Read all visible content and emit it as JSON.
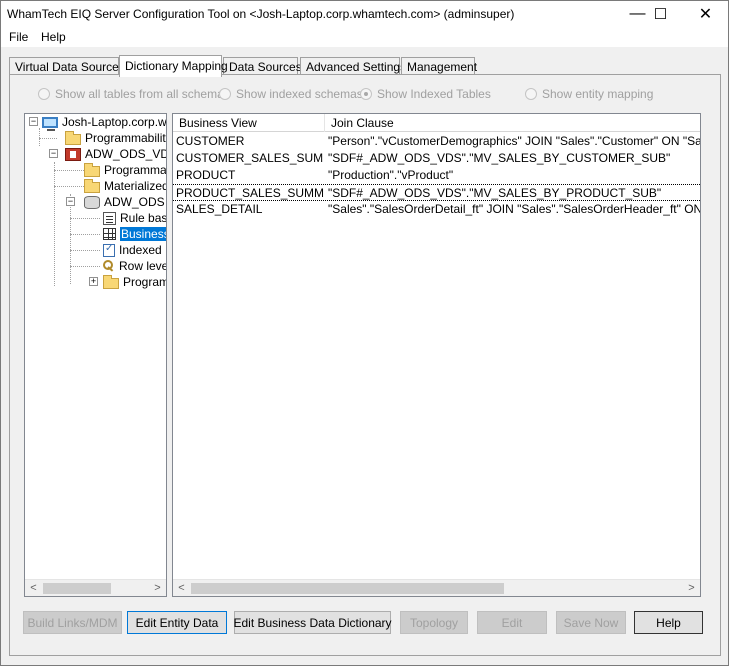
{
  "window": {
    "title": "WhamTech EIQ Server Configuration Tool on <Josh-Laptop.corp.whamtech.com> (adminsuper)",
    "minimize": "—",
    "maximize": "☐",
    "close": "✕"
  },
  "menu": [
    "File",
    "Help"
  ],
  "tabs": [
    "Virtual Data Sources",
    "Dictionary Mapping",
    "Data Sources",
    "Advanced Settings",
    "Management"
  ],
  "active_tab": "Dictionary Mapping",
  "radios": [
    {
      "label": "Show all tables from all schemas",
      "checked": false
    },
    {
      "label": "Show indexed schemas",
      "checked": false
    },
    {
      "label": "Show Indexed Tables",
      "checked": true
    },
    {
      "label": "Show entity mapping",
      "checked": false
    }
  ],
  "tree": {
    "items": [
      {
        "label": "Josh-Laptop.corp.whamtech.com",
        "icon": "computer-icon"
      },
      {
        "label": "Programmability",
        "icon": "folder-icon"
      },
      {
        "label": "ADW_ODS_VDS",
        "icon": "vds-icon"
      },
      {
        "label": "Programmability",
        "icon": "folder-icon"
      },
      {
        "label": "Materialized",
        "icon": "folder-icon"
      },
      {
        "label": "ADW_ODS",
        "icon": "database-icon"
      },
      {
        "label": "Rule base",
        "icon": "rule-icon"
      },
      {
        "label": "Business",
        "icon": "grid-icon"
      },
      {
        "label": "Indexed",
        "icon": "checklist-icon"
      },
      {
        "label": "Row level",
        "icon": "key-icon"
      },
      {
        "label": "Programmability",
        "icon": "folder-icon"
      }
    ],
    "scroll_left": "<",
    "scroll_right": ">"
  },
  "grid": {
    "columns": [
      "Business View",
      "Join Clause"
    ],
    "rows": [
      [
        "CUSTOMER",
        "\"Person\".\"vCustomerDemographics\" JOIN \"Sales\".\"Customer\" ON \"Sales\".\"..."
      ],
      [
        "CUSTOMER_SALES_SUM...",
        "\"SDF#_ADW_ODS_VDS\".\"MV_SALES_BY_CUSTOMER_SUB\""
      ],
      [
        "PRODUCT",
        "\"Production\".\"vProduct\""
      ],
      [
        "PRODUCT_SALES_SUMM...",
        "\"SDF#_ADW_ODS_VDS\".\"MV_SALES_BY_PRODUCT_SUB\""
      ],
      [
        "SALES_DETAIL",
        "\"Sales\".\"SalesOrderDetail_ft\" JOIN \"Sales\".\"SalesOrderHeader_ft\" ON \"Sal..."
      ]
    ],
    "scroll_left": "<",
    "scroll_right": ">"
  },
  "buttons": {
    "build_links": "Build Links/MDM",
    "edit_entity": "Edit Entity Data",
    "edit_bdd": "Edit Business Data Dictionary",
    "topology": "Topology",
    "edit": "Edit",
    "save_now": "Save Now",
    "help": "Help"
  }
}
